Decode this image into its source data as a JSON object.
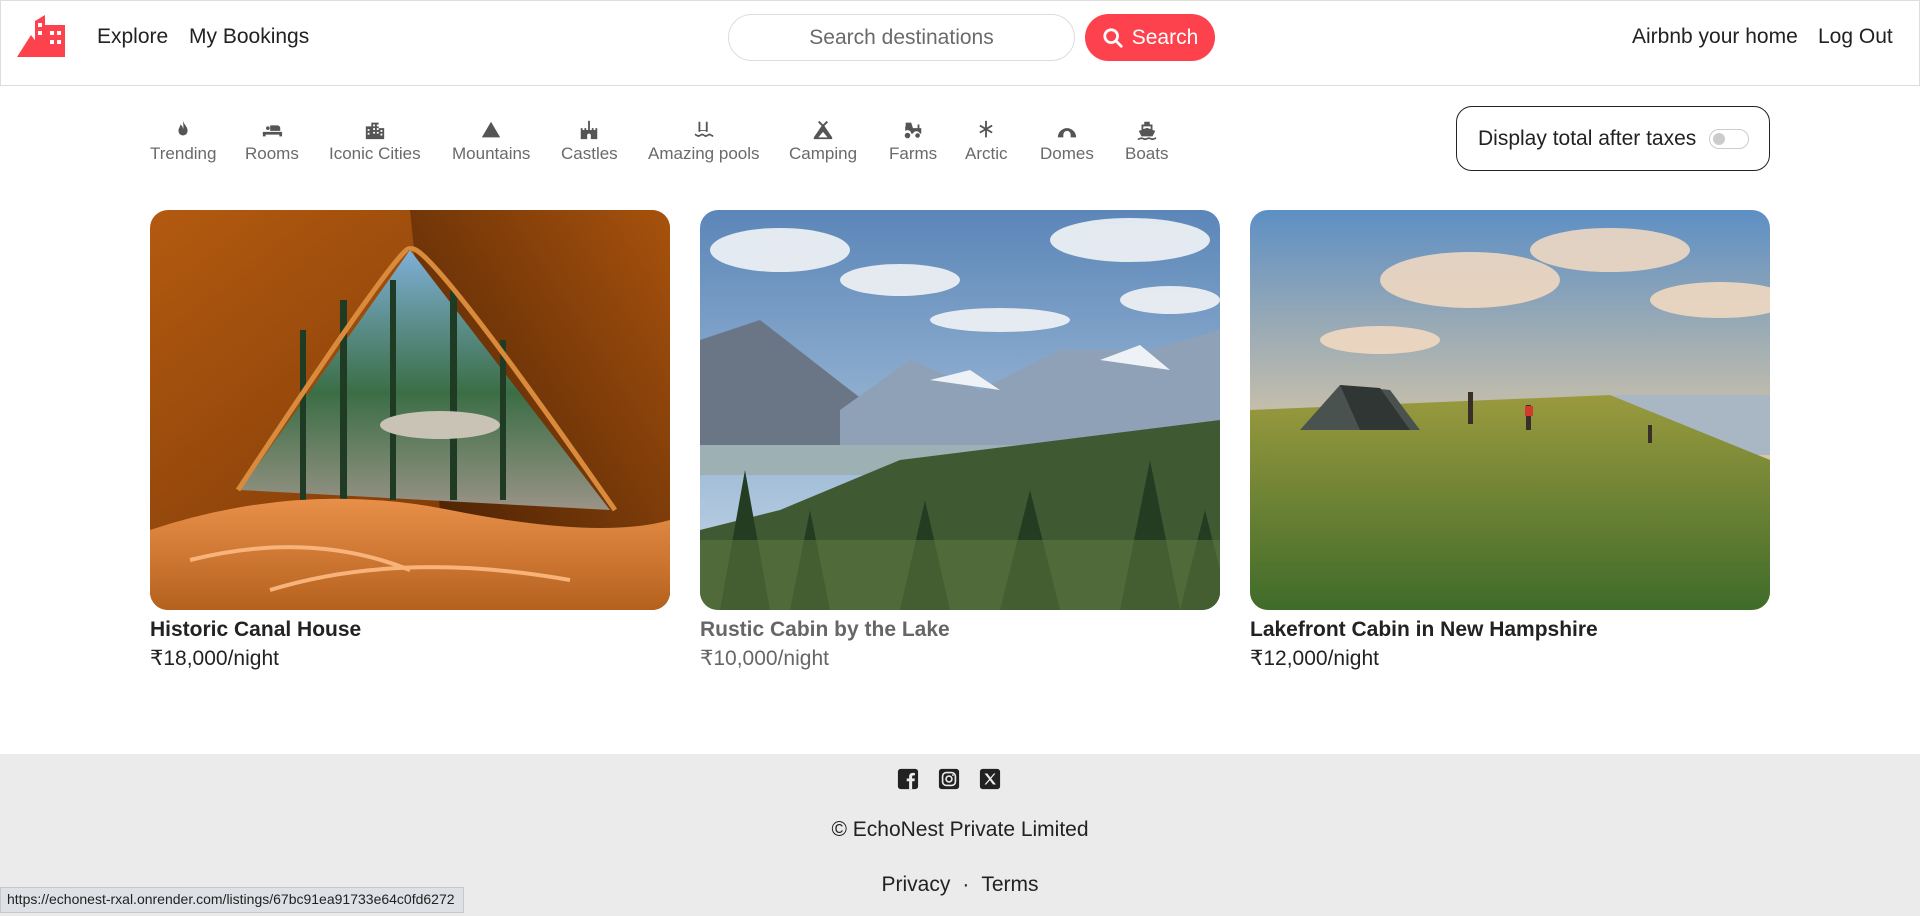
{
  "navbar": {
    "explore": "Explore",
    "my_bookings": "My Bookings",
    "search_placeholder": "Search destinations",
    "search_button": "Search",
    "host": "Airbnb your home",
    "logout": "Log Out",
    "brand_color": "#fe424d"
  },
  "filters": [
    {
      "label": "Trending",
      "icon": "fire-icon"
    },
    {
      "label": "Rooms",
      "icon": "bed-icon"
    },
    {
      "label": "Iconic Cities",
      "icon": "city-icon"
    },
    {
      "label": "Mountains",
      "icon": "mountain-icon"
    },
    {
      "label": "Castles",
      "icon": "castle-icon"
    },
    {
      "label": "Amazing pools",
      "icon": "pool-icon"
    },
    {
      "label": "Camping",
      "icon": "campground-icon"
    },
    {
      "label": "Farms",
      "icon": "tractor-icon"
    },
    {
      "label": "Arctic",
      "icon": "snowflake-icon"
    },
    {
      "label": "Domes",
      "icon": "igloo-icon"
    },
    {
      "label": "Boats",
      "icon": "ship-icon"
    }
  ],
  "tax_toggle": {
    "label": "Display total after taxes",
    "enabled": false
  },
  "listings": [
    {
      "title": "Historic Canal House",
      "price": "₹18,000/night"
    },
    {
      "title": "Rustic Cabin by the Lake",
      "price": "₹10,000/night"
    },
    {
      "title": "Lakefront Cabin in New Hampshire",
      "price": "₹12,000/night"
    }
  ],
  "footer": {
    "social_icons": [
      "facebook-icon",
      "instagram-icon",
      "x-icon"
    ],
    "copyright": "© EchoNest Private Limited",
    "privacy": "Privacy",
    "separator": "·",
    "terms": "Terms"
  },
  "status_url": "https://echonest-rxal.onrender.com/listings/67bc91ea91733e64c0fd6272"
}
